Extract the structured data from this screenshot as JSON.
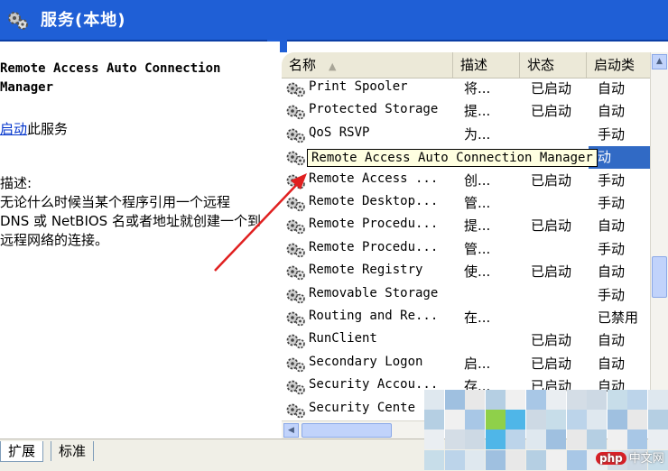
{
  "window": {
    "title": "服务(本地)"
  },
  "detail": {
    "service_title": "Remote Access Auto Connection Manager",
    "start_link": "启动",
    "start_suffix": "此服务",
    "desc_label": "描述:",
    "desc_text": "无论什么时候当某个程序引用一个远程 DNS 或 NetBIOS 名或者地址就创建一个到远程网络的连接。"
  },
  "columns": {
    "name": "名称",
    "desc": "描述",
    "status": "状态",
    "startup": "启动类"
  },
  "rows": [
    {
      "name": "Print Spooler",
      "desc": "将...",
      "status": "已启动",
      "startup": "自动"
    },
    {
      "name": "Protected Storage",
      "desc": "提...",
      "status": "已启动",
      "startup": "自动"
    },
    {
      "name": "QoS RSVP",
      "desc": "为...",
      "status": "",
      "startup": "手动"
    },
    {
      "name": "",
      "desc": "",
      "status": "",
      "startup": "动"
    },
    {
      "name": "Remote Access ...",
      "desc": "创...",
      "status": "已启动",
      "startup": "手动"
    },
    {
      "name": "Remote Desktop...",
      "desc": "管...",
      "status": "",
      "startup": "手动"
    },
    {
      "name": "Remote Procedu...",
      "desc": "提...",
      "status": "已启动",
      "startup": "自动"
    },
    {
      "name": "Remote Procedu...",
      "desc": "管...",
      "status": "",
      "startup": "手动"
    },
    {
      "name": "Remote Registry",
      "desc": "使...",
      "status": "已启动",
      "startup": "自动"
    },
    {
      "name": "Removable Storage",
      "desc": "",
      "status": "",
      "startup": "手动"
    },
    {
      "name": "Routing and Re...",
      "desc": "在...",
      "status": "",
      "startup": "已禁用"
    },
    {
      "name": "RunClient",
      "desc": "",
      "status": "已启动",
      "startup": "自动"
    },
    {
      "name": "Secondary Logon",
      "desc": "启...",
      "status": "已启动",
      "startup": "自动"
    },
    {
      "name": "Security Accou...",
      "desc": "存...",
      "status": "已启动",
      "startup": "自动"
    },
    {
      "name": "Security Cente",
      "desc": "",
      "status": "",
      "startup": ""
    }
  ],
  "tooltip": "Remote Access Auto Connection Manager",
  "tabs": {
    "extended": "扩展",
    "standard": "标准"
  },
  "watermark": {
    "badge": "php",
    "text": "中文网"
  },
  "colors": {
    "title_bar": "#1f5fd6",
    "selection": "#316ac5",
    "tooltip_bg": "#ffffe1",
    "arrow": "#e02020"
  }
}
